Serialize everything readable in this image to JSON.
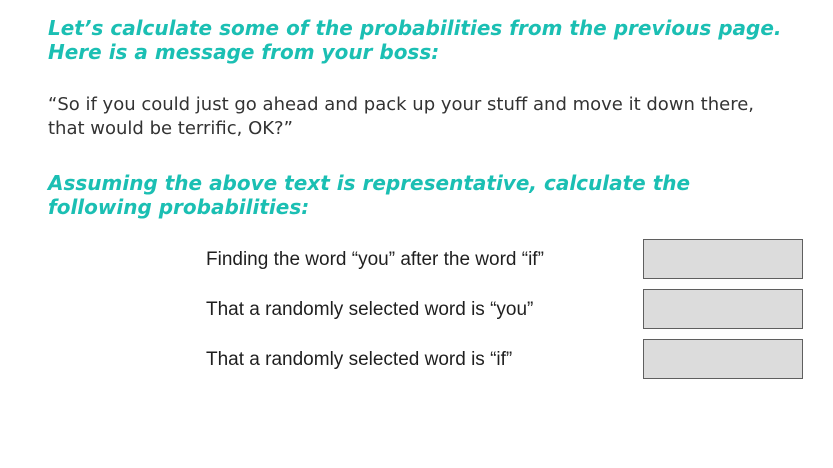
{
  "intro_heading": "Let’s calculate some of the probabilities from the previous page. Here is a message from your boss:",
  "boss_message": "“So if you could just go ahead and pack up your stuff and move it down there, that would be terrific, OK?”",
  "task_heading": "Assuming the above text is representative, calculate the following probabilities:",
  "questions": [
    {
      "label": "Finding the word “you” after the word “if”",
      "answer": ""
    },
    {
      "label": "That a randomly selected word is “you”",
      "answer": ""
    },
    {
      "label": "That a randomly selected word is “if”",
      "answer": ""
    }
  ],
  "colors": {
    "heading": "#1bbfb3",
    "answer_box_fill": "#dcdcdc",
    "answer_box_border": "#5f5f5f"
  }
}
